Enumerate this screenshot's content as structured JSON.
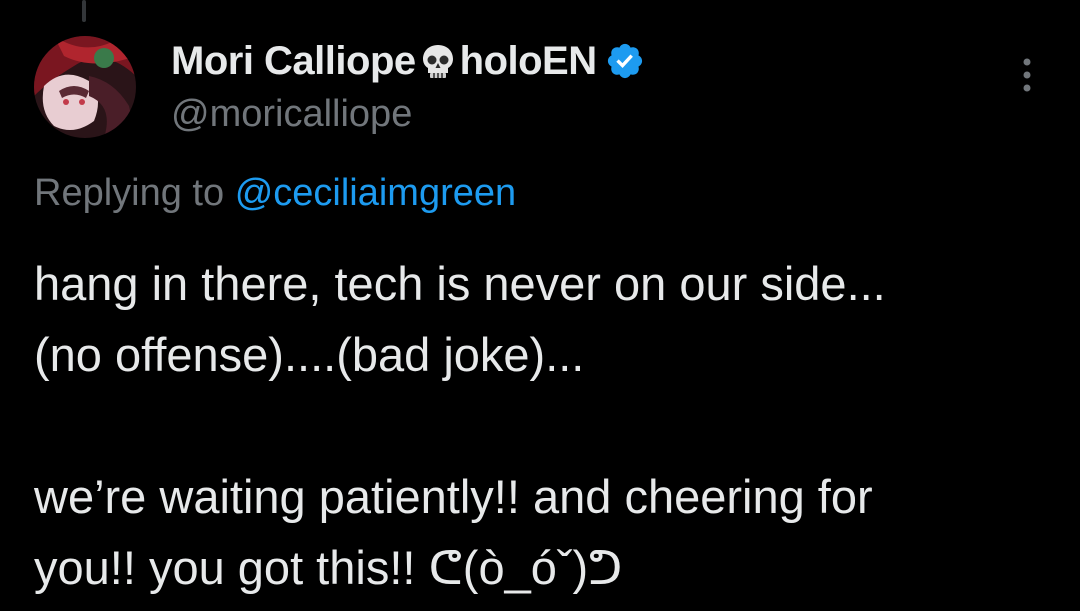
{
  "tweet": {
    "author": {
      "display_name": "Mori Calliope",
      "name_suffix": "holoEN",
      "handle": "@moricalliope",
      "verified": true,
      "name_emoji": "skull-icon"
    },
    "replying_to": {
      "prefix": "Replying to",
      "mention": "@ceciliaimgreen"
    },
    "body_lines": [
      "hang in there, tech is never on our side...",
      "(no offense)....(bad joke)...",
      "",
      "we’re waiting patiently!! and cheering for",
      "you!! you got this!! ᕦ(ò_óˇ)ᕤ"
    ]
  },
  "colors": {
    "background": "#000000",
    "primary_text": "#e7e9ea",
    "secondary_text": "#71767b",
    "accent": "#1d9bf0"
  },
  "icons": {
    "verified": "verified-badge-icon",
    "more": "more-options-icon",
    "name_emoji": "skull-icon"
  }
}
